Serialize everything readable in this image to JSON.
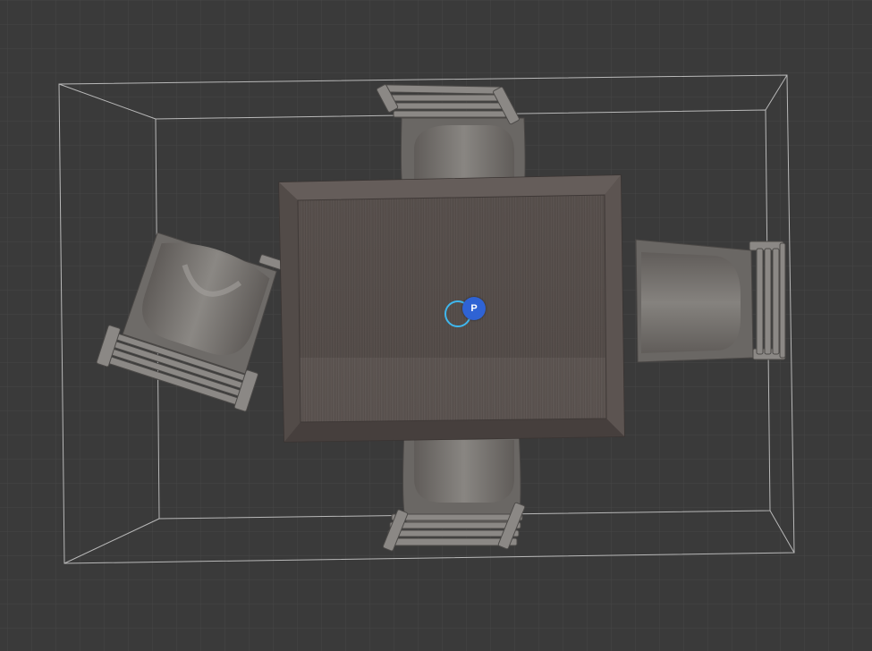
{
  "viewport": {
    "background": "#3a3a3a",
    "grid_color": "#474747",
    "bounding_box_color": "#cfcfcf"
  },
  "scene": {
    "objects": [
      "dining-table",
      "chair-top",
      "chair-bottom",
      "chair-right",
      "chair-left"
    ],
    "wood_color": "#5a5350",
    "chair_color": "#7a7774"
  },
  "pivot": {
    "label": "P",
    "ring_color": "#3fb7ee",
    "badge_color": "#2f63d4",
    "icon": "pivot-gizmo-icon"
  }
}
